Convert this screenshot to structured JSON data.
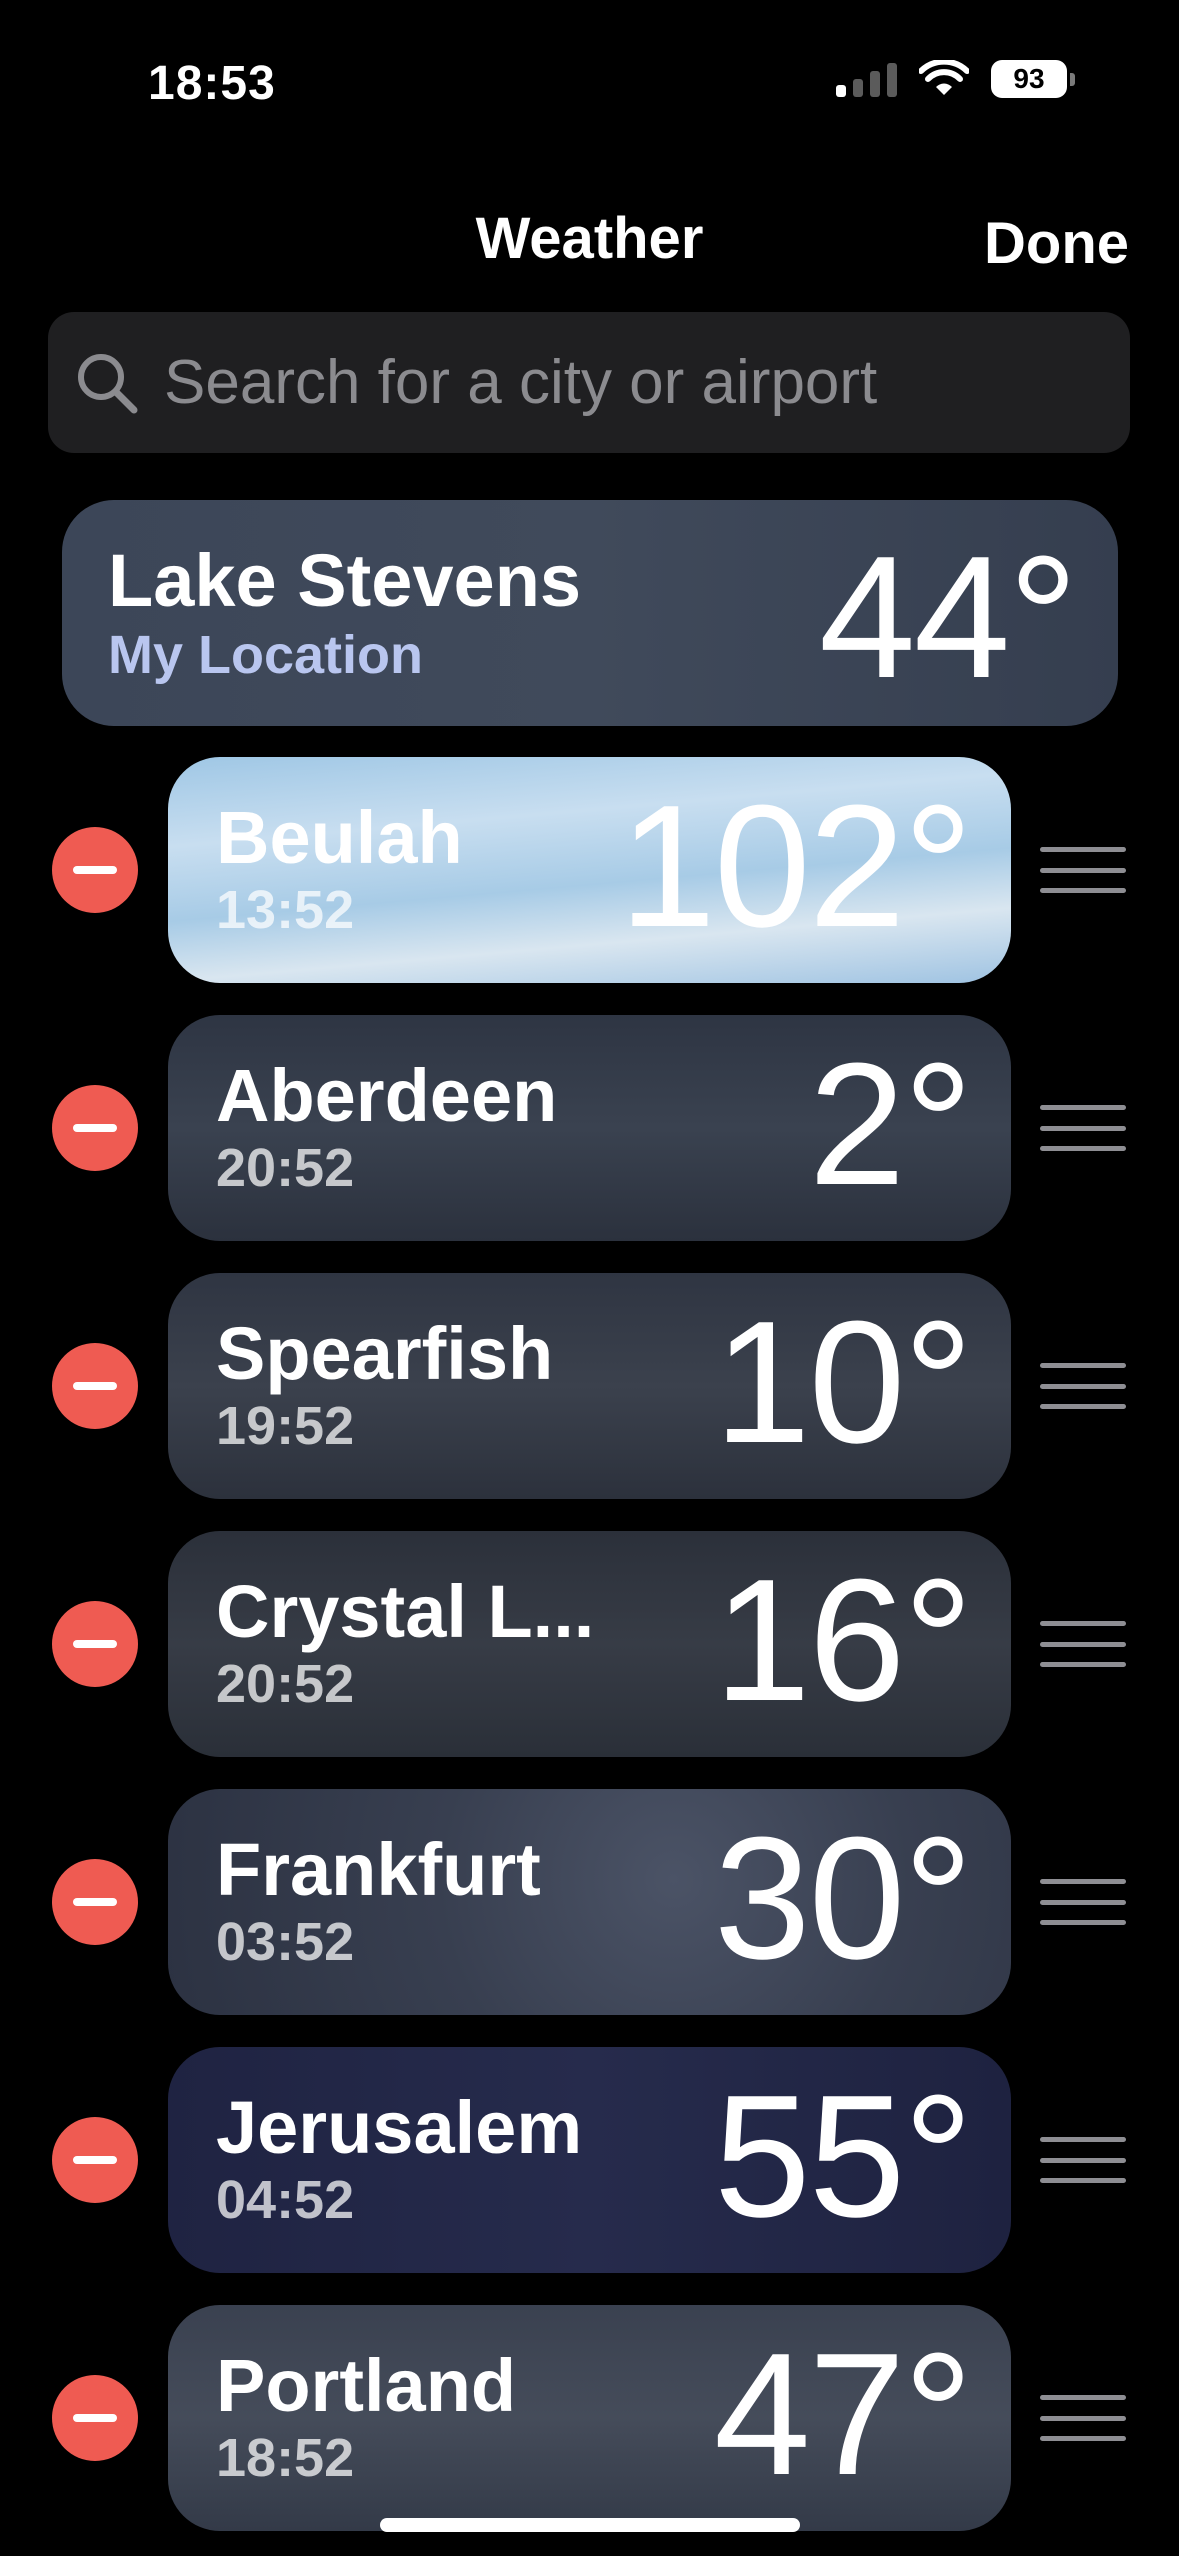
{
  "status_bar": {
    "time": "18:53",
    "battery": "93",
    "icons": [
      "cellular-signal-icon",
      "wifi-icon",
      "battery-icon"
    ]
  },
  "nav": {
    "title": "Weather",
    "done_label": "Done"
  },
  "search": {
    "placeholder": "Search for a city or airport",
    "icon": "search-icon"
  },
  "my_location": {
    "city": "Lake Stevens",
    "label": "My Location",
    "temp": "44°"
  },
  "cities": [
    {
      "city": "Beulah",
      "time": "13:52",
      "temp": "102°",
      "theme": "clear"
    },
    {
      "city": "Aberdeen",
      "time": "20:52",
      "temp": "2°",
      "theme": "cloudy-night"
    },
    {
      "city": "Spearfish",
      "time": "19:52",
      "temp": "10°",
      "theme": "cloudy-night"
    },
    {
      "city": "Crystal L...",
      "time": "20:52",
      "temp": "16°",
      "theme": "cloudy-night"
    },
    {
      "city": "Frankfurt",
      "time": "03:52",
      "temp": "30°",
      "theme": "snow-night"
    },
    {
      "city": "Jerusalem",
      "time": "04:52",
      "temp": "55°",
      "theme": "clear-night"
    },
    {
      "city": "Portland",
      "time": "18:52",
      "temp": "47°",
      "theme": "cloudy-dusk"
    }
  ],
  "colors": {
    "delete": "#ef5b52",
    "background": "#000000",
    "search_bg": "#1f1f21",
    "location_subtitle": "#b9c6ef"
  }
}
